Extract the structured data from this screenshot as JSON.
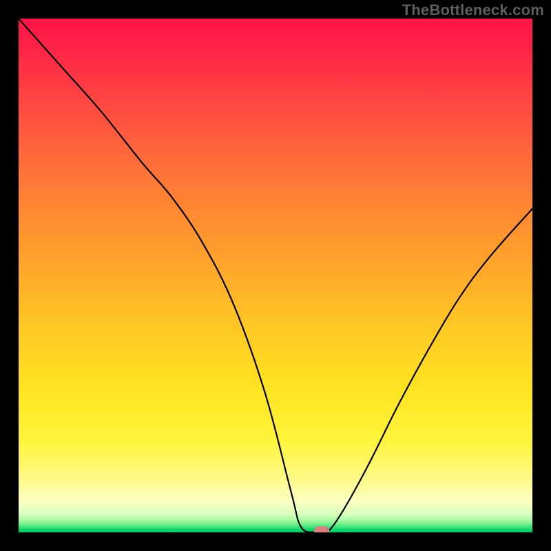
{
  "watermark": "TheBottleneck.com",
  "chart_data": {
    "type": "line",
    "title": "",
    "xlabel": "",
    "ylabel": "",
    "xlim": [
      0,
      100
    ],
    "ylim": [
      0,
      100
    ],
    "grid": false,
    "legend": false,
    "series": [
      {
        "name": "bottleneck-curve",
        "x": [
          0,
          8,
          16,
          24,
          30,
          36,
          42,
          48,
          53,
          55,
          58,
          60,
          63,
          68,
          74,
          80,
          86,
          92,
          100
        ],
        "values": [
          100,
          91,
          82,
          72,
          65,
          56,
          44,
          27,
          8,
          1,
          0,
          0,
          4,
          13,
          25,
          36,
          46,
          54,
          63
        ]
      }
    ],
    "marker": {
      "name": "selected-point",
      "x": 59,
      "y": 0,
      "color": "#d98083"
    },
    "colors": {
      "curve": "#000000",
      "gradient_top": "#ff1449",
      "gradient_bottom": "#08c765",
      "marker": "#d98083"
    }
  }
}
